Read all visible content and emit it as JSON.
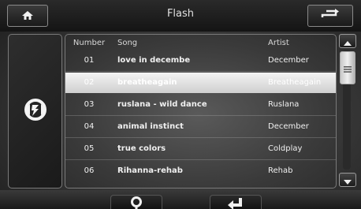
{
  "header": {
    "title": "Flash",
    "home_icon": "home-icon",
    "back_icon": "return-arrow-icon"
  },
  "source": {
    "icon": "flash-source-icon"
  },
  "list": {
    "columns": {
      "number": "Number",
      "song": "Song",
      "artist": "Artist"
    },
    "rows": [
      {
        "number": "01",
        "song": "love in decembe",
        "artist": "December"
      },
      {
        "number": "02",
        "song": "breatheagain",
        "artist": "Breatheagain"
      },
      {
        "number": "03",
        "song": "ruslana - wild dance",
        "artist": "Ruslana"
      },
      {
        "number": "04",
        "song": "animal instinct",
        "artist": "December"
      },
      {
        "number": "05",
        "song": "true colors",
        "artist": "Coldplay"
      },
      {
        "number": "06",
        "song": "Rihanna-rehab",
        "artist": "Rehab"
      }
    ],
    "selected_index": 1
  },
  "scrollbar": {
    "up_icon": "arrow-up-icon",
    "down_icon": "arrow-down-icon",
    "thumb_icon": "grip-lines-icon"
  },
  "footer": {
    "search_icon": "search-icon",
    "enter_icon": "enter-icon"
  }
}
